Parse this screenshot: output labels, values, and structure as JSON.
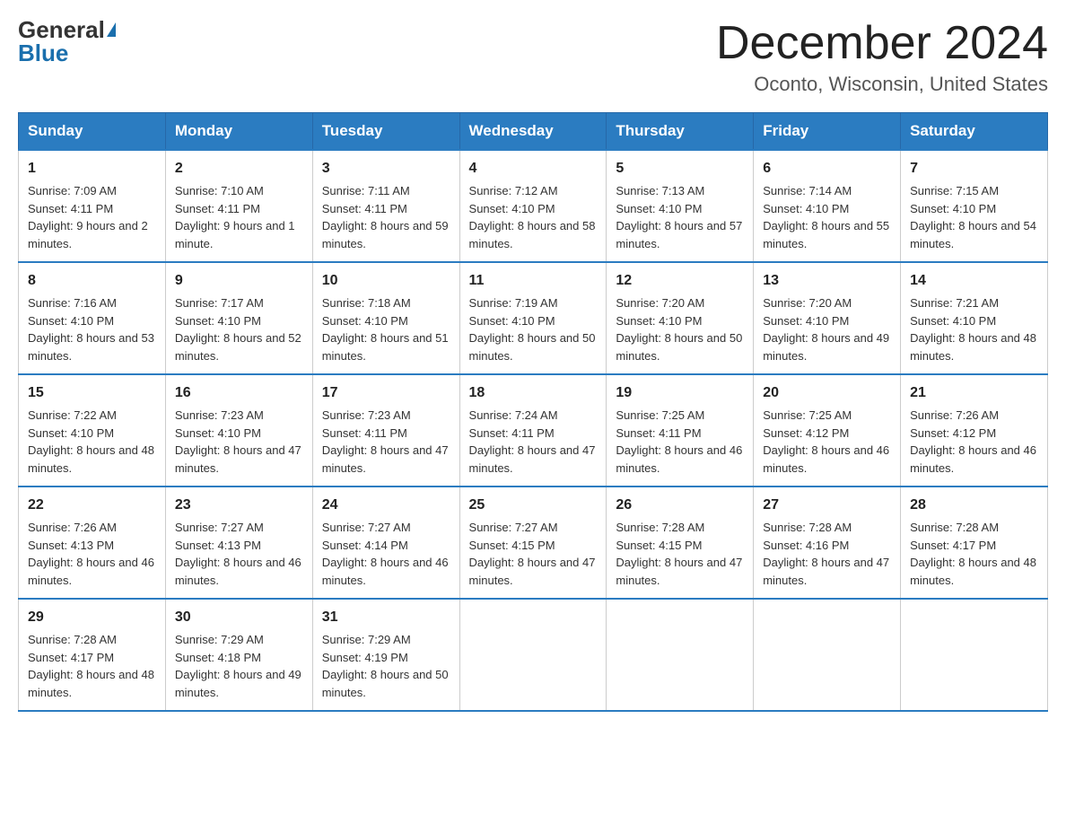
{
  "header": {
    "logo_general": "General",
    "logo_blue": "Blue",
    "month_title": "December 2024",
    "location": "Oconto, Wisconsin, United States"
  },
  "weekdays": [
    "Sunday",
    "Monday",
    "Tuesday",
    "Wednesday",
    "Thursday",
    "Friday",
    "Saturday"
  ],
  "weeks": [
    [
      {
        "day": "1",
        "sunrise": "Sunrise: 7:09 AM",
        "sunset": "Sunset: 4:11 PM",
        "daylight": "Daylight: 9 hours and 2 minutes."
      },
      {
        "day": "2",
        "sunrise": "Sunrise: 7:10 AM",
        "sunset": "Sunset: 4:11 PM",
        "daylight": "Daylight: 9 hours and 1 minute."
      },
      {
        "day": "3",
        "sunrise": "Sunrise: 7:11 AM",
        "sunset": "Sunset: 4:11 PM",
        "daylight": "Daylight: 8 hours and 59 minutes."
      },
      {
        "day": "4",
        "sunrise": "Sunrise: 7:12 AM",
        "sunset": "Sunset: 4:10 PM",
        "daylight": "Daylight: 8 hours and 58 minutes."
      },
      {
        "day": "5",
        "sunrise": "Sunrise: 7:13 AM",
        "sunset": "Sunset: 4:10 PM",
        "daylight": "Daylight: 8 hours and 57 minutes."
      },
      {
        "day": "6",
        "sunrise": "Sunrise: 7:14 AM",
        "sunset": "Sunset: 4:10 PM",
        "daylight": "Daylight: 8 hours and 55 minutes."
      },
      {
        "day": "7",
        "sunrise": "Sunrise: 7:15 AM",
        "sunset": "Sunset: 4:10 PM",
        "daylight": "Daylight: 8 hours and 54 minutes."
      }
    ],
    [
      {
        "day": "8",
        "sunrise": "Sunrise: 7:16 AM",
        "sunset": "Sunset: 4:10 PM",
        "daylight": "Daylight: 8 hours and 53 minutes."
      },
      {
        "day": "9",
        "sunrise": "Sunrise: 7:17 AM",
        "sunset": "Sunset: 4:10 PM",
        "daylight": "Daylight: 8 hours and 52 minutes."
      },
      {
        "day": "10",
        "sunrise": "Sunrise: 7:18 AM",
        "sunset": "Sunset: 4:10 PM",
        "daylight": "Daylight: 8 hours and 51 minutes."
      },
      {
        "day": "11",
        "sunrise": "Sunrise: 7:19 AM",
        "sunset": "Sunset: 4:10 PM",
        "daylight": "Daylight: 8 hours and 50 minutes."
      },
      {
        "day": "12",
        "sunrise": "Sunrise: 7:20 AM",
        "sunset": "Sunset: 4:10 PM",
        "daylight": "Daylight: 8 hours and 50 minutes."
      },
      {
        "day": "13",
        "sunrise": "Sunrise: 7:20 AM",
        "sunset": "Sunset: 4:10 PM",
        "daylight": "Daylight: 8 hours and 49 minutes."
      },
      {
        "day": "14",
        "sunrise": "Sunrise: 7:21 AM",
        "sunset": "Sunset: 4:10 PM",
        "daylight": "Daylight: 8 hours and 48 minutes."
      }
    ],
    [
      {
        "day": "15",
        "sunrise": "Sunrise: 7:22 AM",
        "sunset": "Sunset: 4:10 PM",
        "daylight": "Daylight: 8 hours and 48 minutes."
      },
      {
        "day": "16",
        "sunrise": "Sunrise: 7:23 AM",
        "sunset": "Sunset: 4:10 PM",
        "daylight": "Daylight: 8 hours and 47 minutes."
      },
      {
        "day": "17",
        "sunrise": "Sunrise: 7:23 AM",
        "sunset": "Sunset: 4:11 PM",
        "daylight": "Daylight: 8 hours and 47 minutes."
      },
      {
        "day": "18",
        "sunrise": "Sunrise: 7:24 AM",
        "sunset": "Sunset: 4:11 PM",
        "daylight": "Daylight: 8 hours and 47 minutes."
      },
      {
        "day": "19",
        "sunrise": "Sunrise: 7:25 AM",
        "sunset": "Sunset: 4:11 PM",
        "daylight": "Daylight: 8 hours and 46 minutes."
      },
      {
        "day": "20",
        "sunrise": "Sunrise: 7:25 AM",
        "sunset": "Sunset: 4:12 PM",
        "daylight": "Daylight: 8 hours and 46 minutes."
      },
      {
        "day": "21",
        "sunrise": "Sunrise: 7:26 AM",
        "sunset": "Sunset: 4:12 PM",
        "daylight": "Daylight: 8 hours and 46 minutes."
      }
    ],
    [
      {
        "day": "22",
        "sunrise": "Sunrise: 7:26 AM",
        "sunset": "Sunset: 4:13 PM",
        "daylight": "Daylight: 8 hours and 46 minutes."
      },
      {
        "day": "23",
        "sunrise": "Sunrise: 7:27 AM",
        "sunset": "Sunset: 4:13 PM",
        "daylight": "Daylight: 8 hours and 46 minutes."
      },
      {
        "day": "24",
        "sunrise": "Sunrise: 7:27 AM",
        "sunset": "Sunset: 4:14 PM",
        "daylight": "Daylight: 8 hours and 46 minutes."
      },
      {
        "day": "25",
        "sunrise": "Sunrise: 7:27 AM",
        "sunset": "Sunset: 4:15 PM",
        "daylight": "Daylight: 8 hours and 47 minutes."
      },
      {
        "day": "26",
        "sunrise": "Sunrise: 7:28 AM",
        "sunset": "Sunset: 4:15 PM",
        "daylight": "Daylight: 8 hours and 47 minutes."
      },
      {
        "day": "27",
        "sunrise": "Sunrise: 7:28 AM",
        "sunset": "Sunset: 4:16 PM",
        "daylight": "Daylight: 8 hours and 47 minutes."
      },
      {
        "day": "28",
        "sunrise": "Sunrise: 7:28 AM",
        "sunset": "Sunset: 4:17 PM",
        "daylight": "Daylight: 8 hours and 48 minutes."
      }
    ],
    [
      {
        "day": "29",
        "sunrise": "Sunrise: 7:28 AM",
        "sunset": "Sunset: 4:17 PM",
        "daylight": "Daylight: 8 hours and 48 minutes."
      },
      {
        "day": "30",
        "sunrise": "Sunrise: 7:29 AM",
        "sunset": "Sunset: 4:18 PM",
        "daylight": "Daylight: 8 hours and 49 minutes."
      },
      {
        "day": "31",
        "sunrise": "Sunrise: 7:29 AM",
        "sunset": "Sunset: 4:19 PM",
        "daylight": "Daylight: 8 hours and 50 minutes."
      },
      null,
      null,
      null,
      null
    ]
  ]
}
